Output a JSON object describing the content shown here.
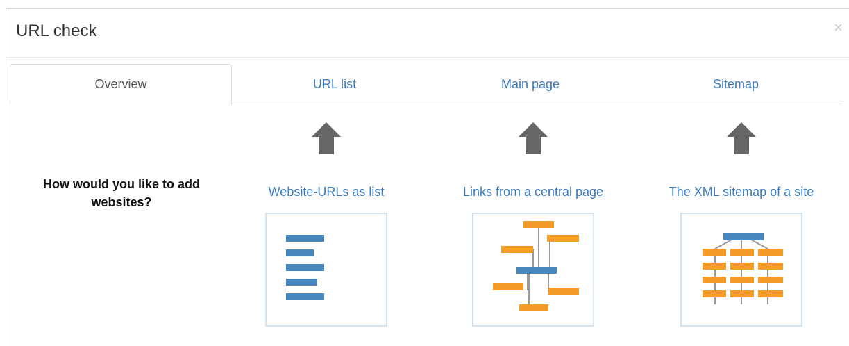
{
  "modal": {
    "title": "URL check",
    "close_label": "×"
  },
  "tabs": [
    {
      "label": "Overview"
    },
    {
      "label": "URL list"
    },
    {
      "label": "Main page"
    },
    {
      "label": "Sitemap"
    }
  ],
  "question": "How would you like to add websites?",
  "options": [
    {
      "title": "Website-URLs as list",
      "icon": "list-illustration"
    },
    {
      "title": "Links from a central page",
      "icon": "links-tree-illustration"
    },
    {
      "title": "The XML sitemap of a site",
      "icon": "sitemap-grid-illustration"
    }
  ],
  "colors": {
    "link": "#3b7bbf",
    "bar_blue": "#4a86be",
    "bar_orange": "#f39c29",
    "arrow": "#666666"
  }
}
